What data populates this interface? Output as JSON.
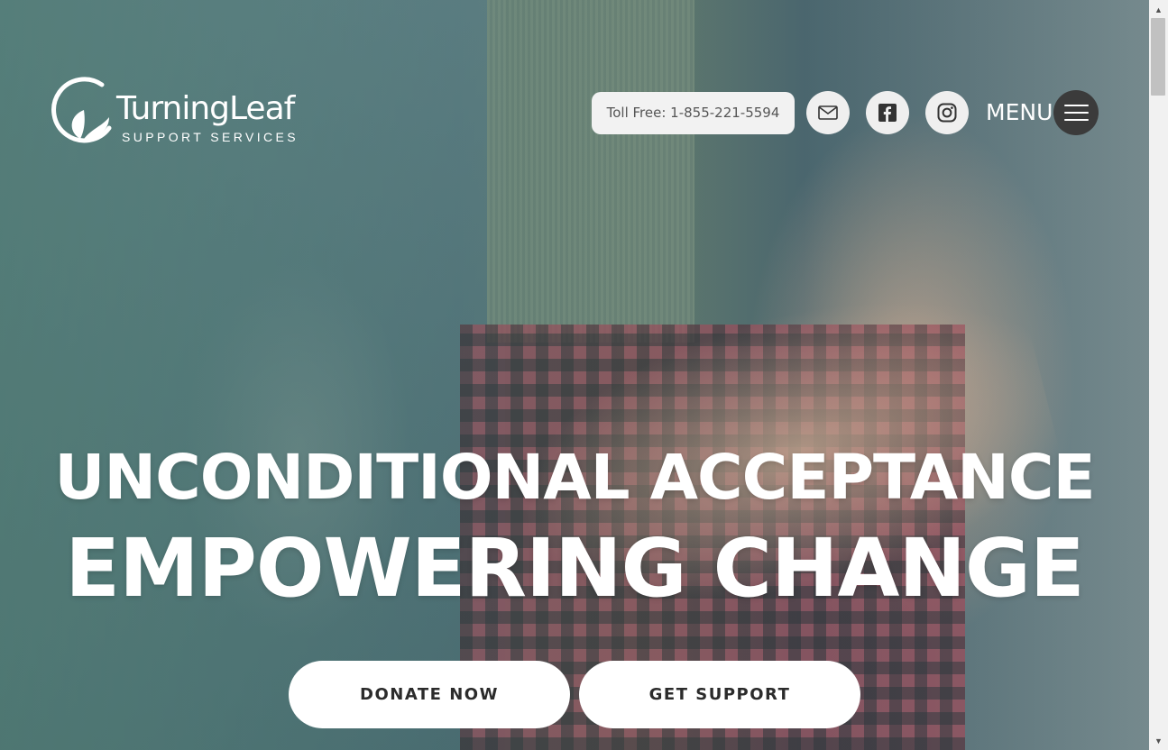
{
  "brand": {
    "name": "TurningLeaf",
    "tagline": "SUPPORT SERVICES"
  },
  "header": {
    "toll_free": "Toll Free: 1-855-221-5594",
    "menu_label": "MENU",
    "icons": [
      "mail-icon",
      "facebook-icon",
      "instagram-icon",
      "hamburger-icon"
    ]
  },
  "hero": {
    "line1": "UNCONDITIONAL ACCEPTANCE",
    "line2": "EMPOWERING CHANGE",
    "donate_label": "DONATE NOW",
    "support_label": "GET SUPPORT"
  },
  "colors": {
    "button_bg": "#ffffff",
    "button_text": "#2b2b2b",
    "hamburger_bg": "#3b3b3b",
    "toll_bg": "#f2f2f2"
  }
}
